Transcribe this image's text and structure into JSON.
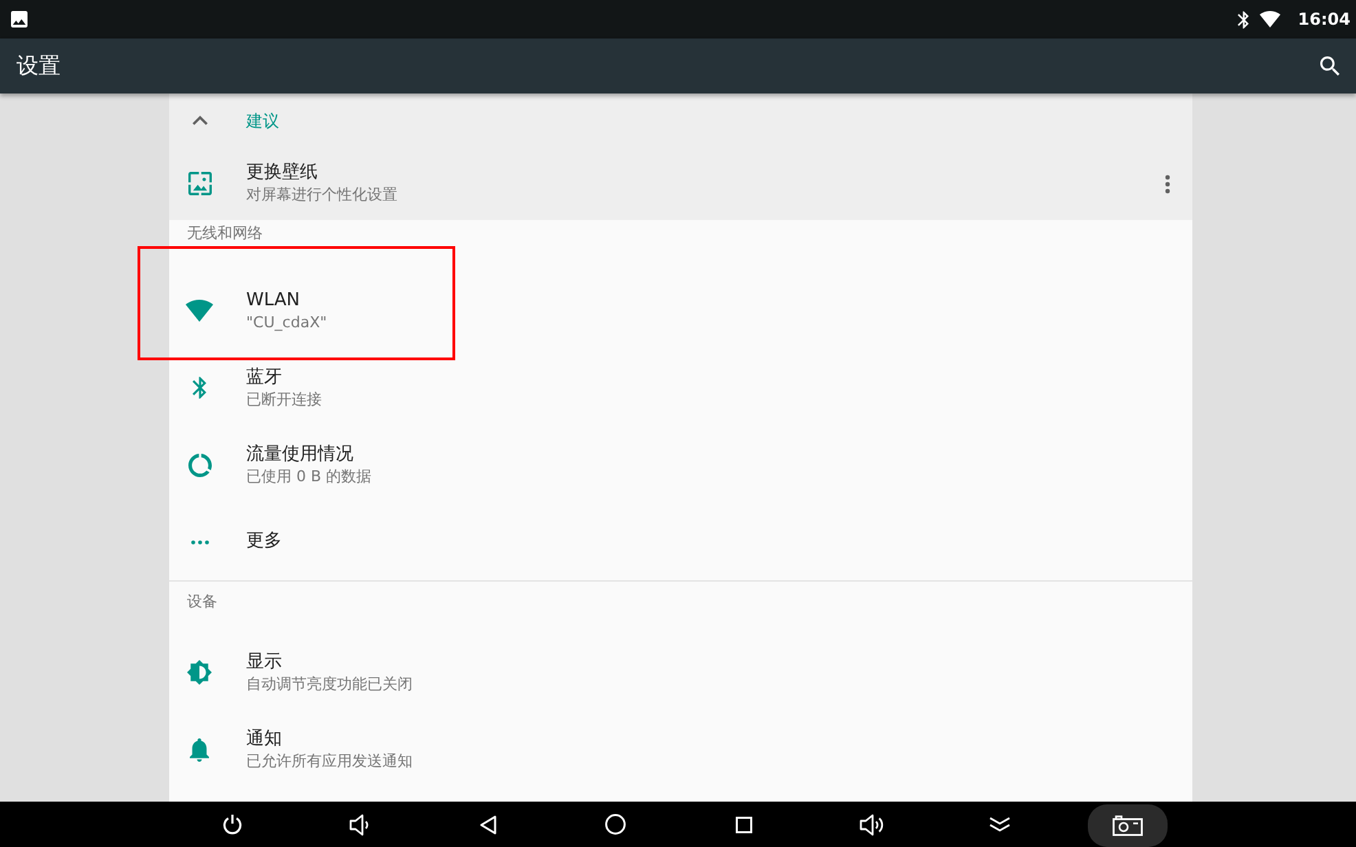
{
  "status_bar": {
    "time": "16:04"
  },
  "app_bar": {
    "title": "设置"
  },
  "suggestions": {
    "header": "建议",
    "expanded": true,
    "items": [
      {
        "title": "更换壁纸",
        "summary": "对屏幕进行个性化设置"
      }
    ]
  },
  "categories": [
    {
      "header": "无线和网络",
      "items": [
        {
          "title": "WLAN",
          "summary": "\"CU_cdaX\"",
          "highlighted": true
        },
        {
          "title": "蓝牙",
          "summary": "已断开连接",
          "highlighted": false
        },
        {
          "title": "流量使用情况",
          "summary": "已使用 0 B 的数据",
          "highlighted": false
        },
        {
          "title": "更多",
          "highlighted": false
        }
      ]
    },
    {
      "header": "设备",
      "items": [
        {
          "title": "显示",
          "summary": "自动调节亮度功能已关闭",
          "highlighted": false
        },
        {
          "title": "通知",
          "summary": "已允许所有应用发送通知",
          "highlighted": false
        }
      ]
    }
  ]
}
